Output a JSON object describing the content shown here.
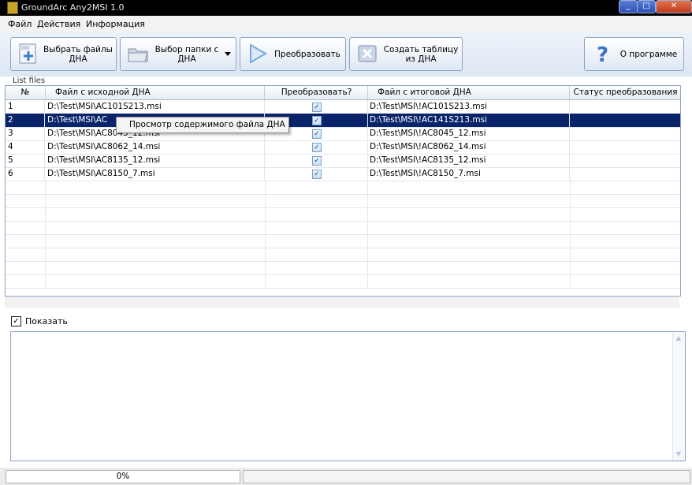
{
  "window": {
    "title": "GroundArc Any2MSI  1.0",
    "min": "_",
    "max": "□",
    "close": "✕"
  },
  "menu": {
    "file": "Файл",
    "actions": "Действия",
    "info": "Информация"
  },
  "toolbar": {
    "select_files": "Выбрать файлы ДНА",
    "select_folder": "Выбор папки с ДНА",
    "convert": "Преобразовать",
    "create_table": "Создать таблицу из ДНА",
    "about": "О программе"
  },
  "list_label": "List files",
  "table": {
    "headers": [
      "№",
      "Файл с исходной ДНА",
      "Преобразовать?",
      "Файл с итоговой ДНА",
      "Статус преобразования"
    ],
    "rows": [
      {
        "num": "1",
        "src": "D:\\Test\\MSI\\AC101S213.msi",
        "convert": true,
        "dst": "D:\\Test\\MSI\\!AC101S213.msi",
        "status": ""
      },
      {
        "num": "2",
        "src": "D:\\Test\\MSI\\AC",
        "convert": true,
        "dst": "D:\\Test\\MSI\\!AC141S213.msi",
        "status": ""
      },
      {
        "num": "3",
        "src": "D:\\Test\\MSI\\AC8045_12.msi",
        "convert": true,
        "dst": "D:\\Test\\MSI\\!AC8045_12.msi",
        "status": ""
      },
      {
        "num": "4",
        "src": "D:\\Test\\MSI\\AC8062_14.msi",
        "convert": true,
        "dst": "D:\\Test\\MSI\\!AC8062_14.msi",
        "status": ""
      },
      {
        "num": "5",
        "src": "D:\\Test\\MSI\\AC8135_12.msi",
        "convert": true,
        "dst": "D:\\Test\\MSI\\!AC8135_12.msi",
        "status": ""
      },
      {
        "num": "6",
        "src": "D:\\Test\\MSI\\AC8150_7.msi",
        "convert": true,
        "dst": "D:\\Test\\MSI\\!AC8150_7.msi",
        "status": ""
      }
    ],
    "selected_row": 2
  },
  "context_menu": {
    "item": "Просмотр содержимого файла ДНА"
  },
  "log": {
    "show_label": "Показать",
    "show_checked": true
  },
  "status": {
    "progress_text": "0%",
    "progress": 0
  }
}
